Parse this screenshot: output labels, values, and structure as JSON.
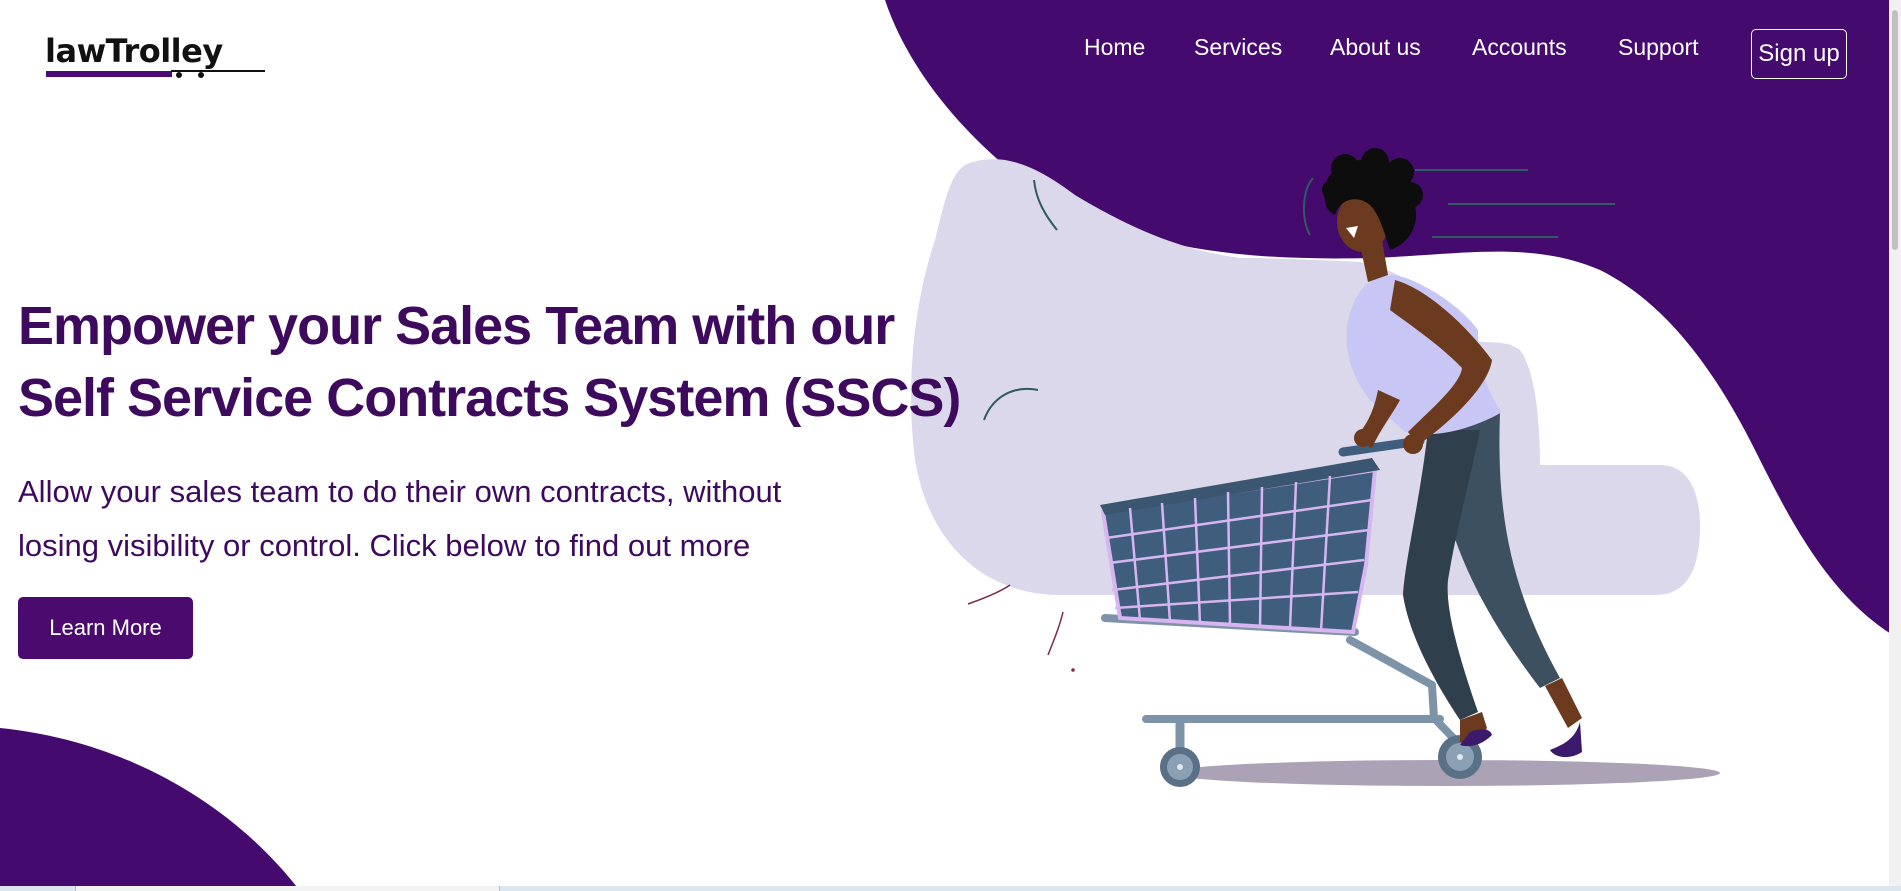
{
  "brand": {
    "name": "lawTrolley",
    "accent": "#450a6e",
    "text_color": "#3d0a5e"
  },
  "nav": {
    "items": [
      {
        "label": "Home"
      },
      {
        "label": "Services"
      },
      {
        "label": "About us"
      },
      {
        "label": "Accounts"
      },
      {
        "label": "Support"
      }
    ],
    "signup_label": "Sign up"
  },
  "hero": {
    "title_line1": "Empower your Sales Team with our",
    "title_line2": "Self Service Contracts System (SSCS)",
    "subtitle_line1": "Allow your sales team to do their own contracts, without",
    "subtitle_line2": "losing visibility or control. Click below to find out more",
    "button_label": "Learn More"
  },
  "illustration": {
    "subject": "woman-pushing-shopping-cart"
  }
}
